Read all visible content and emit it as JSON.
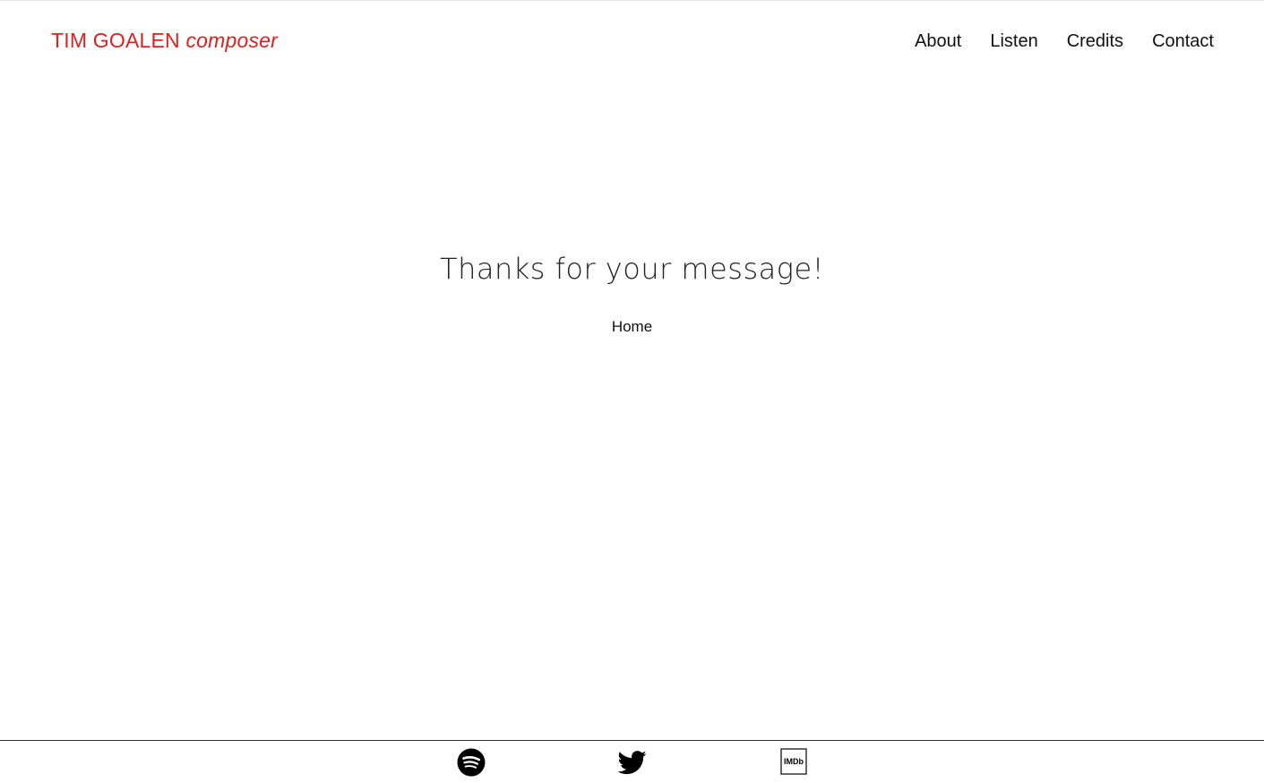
{
  "header": {
    "brand_name": "TIM GOALEN",
    "brand_role": "composer",
    "nav": [
      {
        "label": "About"
      },
      {
        "label": "Listen"
      },
      {
        "label": "Credits"
      },
      {
        "label": "Contact"
      }
    ]
  },
  "main": {
    "heading": "Thanks for your message!",
    "home_link": "Home"
  },
  "footer": {
    "social": [
      {
        "icon": "spotify-icon"
      },
      {
        "icon": "twitter-icon"
      },
      {
        "icon": "imdb-icon",
        "label": "IMDb"
      }
    ]
  },
  "colors": {
    "brand": "#e0201f",
    "text": "#111111",
    "background": "#ffffff"
  }
}
